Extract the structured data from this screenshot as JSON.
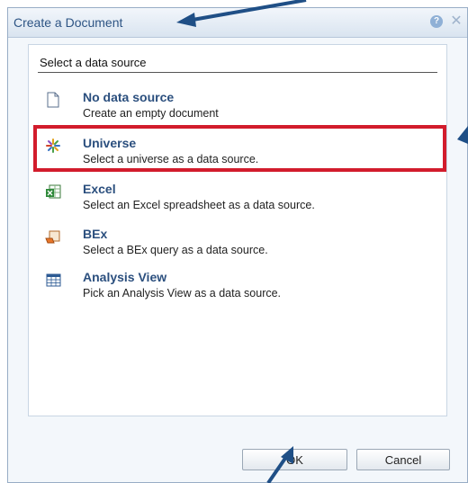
{
  "dialog": {
    "title": "Create a Document",
    "help_glyph": "?",
    "close_glyph": "✕"
  },
  "section": {
    "title": "Select a data source"
  },
  "options": [
    {
      "title": "No data source",
      "description": "Create an empty document",
      "icon": "blank-document-icon"
    },
    {
      "title": "Universe",
      "description": "Select a universe as a data source.",
      "icon": "universe-icon"
    },
    {
      "title": "Excel",
      "description": "Select an Excel spreadsheet as a data source.",
      "icon": "excel-icon"
    },
    {
      "title": "BEx",
      "description": "Select a BEx query as a data source.",
      "icon": "bex-icon"
    },
    {
      "title": "Analysis View",
      "description": "Pick an Analysis View as a data source.",
      "icon": "analysis-view-icon"
    }
  ],
  "buttons": {
    "ok": "OK",
    "cancel": "Cancel"
  },
  "colors": {
    "title_text": "#2d5484",
    "highlight_border": "#d21c2c",
    "arrow": "#1f4f86"
  }
}
